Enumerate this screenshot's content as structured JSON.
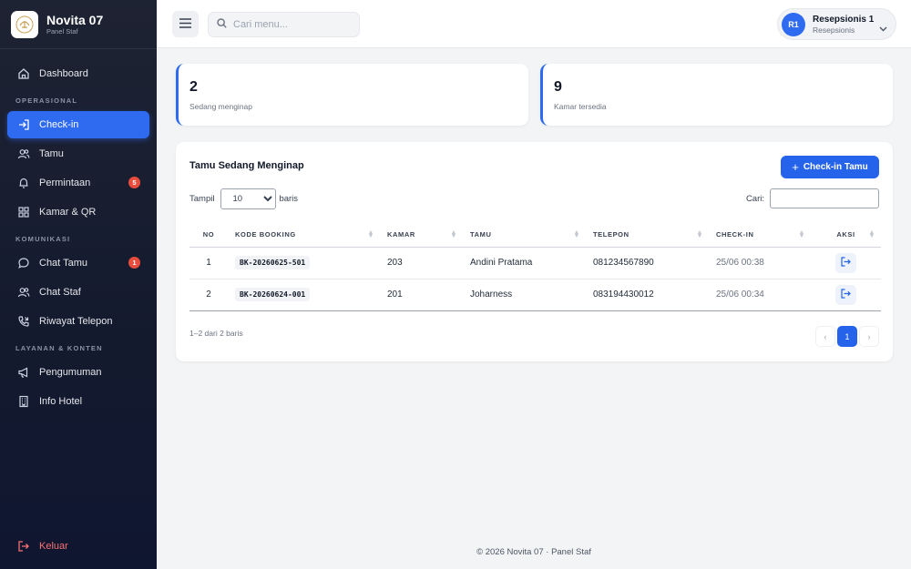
{
  "brand": {
    "name": "Novita 07",
    "subtitle": "Panel Staf"
  },
  "nav": {
    "dashboard": "Dashboard",
    "section_operasional": "OPERASIONAL",
    "checkin": "Check-in",
    "tamu": "Tamu",
    "permintaan": "Permintaan",
    "permintaan_badge": "5",
    "kamar": "Kamar & QR",
    "section_komunikasi": "KOMUNIKASI",
    "chat_tamu": "Chat Tamu",
    "chat_tamu_badge": "1",
    "chat_staf": "Chat Staf",
    "riwayat": "Riwayat Telepon",
    "section_layanan": "LAYANAN & KONTEN",
    "pengumuman": "Pengumuman",
    "info_hotel": "Info Hotel",
    "logout": "Keluar"
  },
  "topbar": {
    "search_placeholder": "Cari menu...",
    "user_initials": "R1",
    "user_name": "Resepsionis 1",
    "user_role": "Resepsionis"
  },
  "stats": [
    {
      "value": "2",
      "label": "Sedang menginap"
    },
    {
      "value": "9",
      "label": "Kamar tersedia"
    }
  ],
  "card": {
    "title": "Tamu Sedang Menginap",
    "add_button": "Check-in Tamu",
    "show_label": "Tampil",
    "show_value": "10",
    "rows_label": "baris",
    "search_label": "Cari:",
    "info": "1–2 dari 2 baris",
    "page_current": "1",
    "page_prev": "‹",
    "page_next": "›"
  },
  "table": {
    "headers": [
      "NO",
      "KODE BOOKING",
      "KAMAR",
      "TAMU",
      "TELEPON",
      "CHECK-IN",
      "AKSI"
    ],
    "rows": [
      {
        "no": "1",
        "code": "BK-20260625-501",
        "room": "203",
        "guest": "Andini Pratama",
        "phone": "081234567890",
        "checkin": "25/06 00:38"
      },
      {
        "no": "2",
        "code": "BK-20260624-001",
        "room": "201",
        "guest": "Joharness",
        "phone": "083194430012",
        "checkin": "25/06 00:34"
      }
    ]
  },
  "footer": "© 2026 Novita 07 · Panel Staf",
  "colors": {
    "accent": "#2f6bf0",
    "sidebar": "#141a2e",
    "danger": "#e74c3c",
    "logout": "#f87171"
  }
}
